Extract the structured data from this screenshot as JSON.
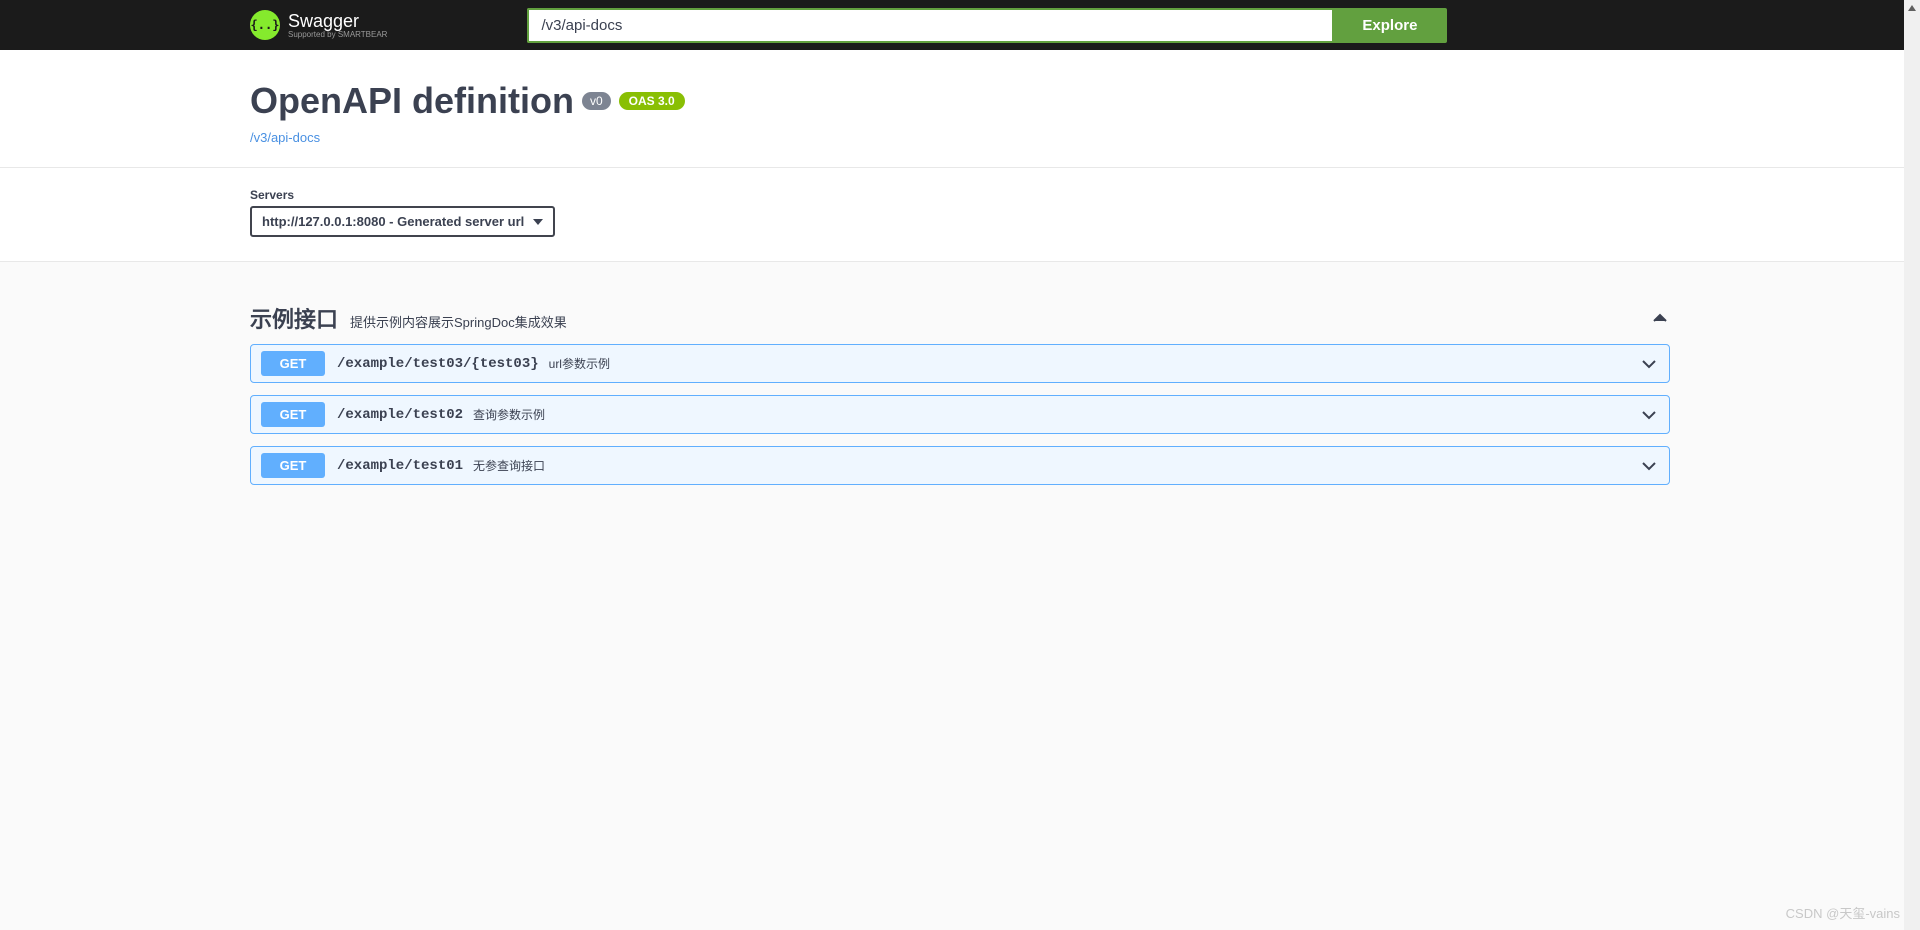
{
  "topbar": {
    "logo_text": "Swagger",
    "logo_subtext": "Supported by SMARTBEAR",
    "url_input_value": "/v3/api-docs",
    "explore_label": "Explore"
  },
  "info": {
    "title": "OpenAPI definition",
    "version_badge": "v0",
    "oas_badge": "OAS 3.0",
    "docs_link": "/v3/api-docs"
  },
  "servers": {
    "label": "Servers",
    "selected": "http://127.0.0.1:8080 - Generated server url"
  },
  "tag": {
    "name": "示例接口",
    "description": "提供示例内容展示SpringDoc集成效果"
  },
  "operations": [
    {
      "method": "GET",
      "path": "/example/test03/{test03}",
      "summary": "url参数示例"
    },
    {
      "method": "GET",
      "path": "/example/test02",
      "summary": "查询参数示例"
    },
    {
      "method": "GET",
      "path": "/example/test01",
      "summary": "无参查询接口"
    }
  ],
  "watermark": "CSDN @天玺-vains"
}
